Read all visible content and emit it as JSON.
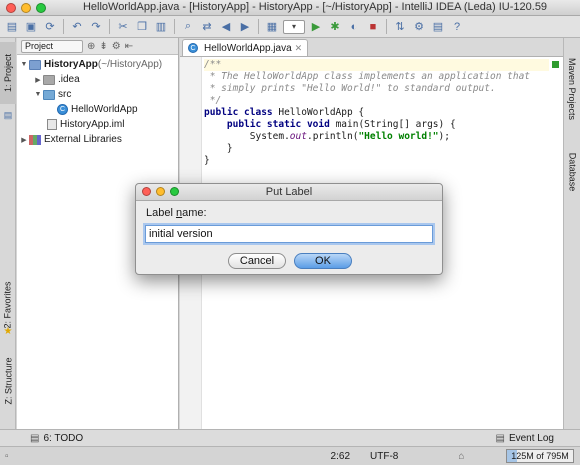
{
  "window": {
    "title": "HelloWorldApp.java - [HistoryApp] - HistoryApp - [~/HistoryApp] - IntelliJ IDEA (Leda) IU-120.59"
  },
  "toolbar": {
    "icons": [
      "open-icon",
      "save-icon",
      "sync-icon",
      "undo-icon",
      "redo-icon",
      "cut-icon",
      "copy-icon",
      "paste-icon",
      "find-icon",
      "replace-icon",
      "back-icon",
      "forward-icon",
      "make-icon",
      "run-config-combo",
      "run-icon",
      "debug-icon",
      "coverage-icon",
      "stop-icon",
      "vcs-icon",
      "settings-icon",
      "structure-icon",
      "help-icon"
    ]
  },
  "left_strip": {
    "project_tab": "1: Project",
    "favorites_tab": "2: Favorites",
    "structure_tab": "Z: Structure"
  },
  "right_strip": {
    "maven_tab": "Maven Projects",
    "database_tab": "Database"
  },
  "project_panel": {
    "view_selector": "Project",
    "tree": [
      {
        "label": "HistoryApp",
        "suffix": " (~/HistoryApp)",
        "level": 0,
        "expanded": true,
        "icon": "folder"
      },
      {
        "label": ".idea",
        "suffix": "",
        "level": 1,
        "expanded": false,
        "icon": "folder-plain"
      },
      {
        "label": "src",
        "suffix": "",
        "level": 1,
        "expanded": true,
        "icon": "folder-src"
      },
      {
        "label": "HelloWorldApp",
        "suffix": "",
        "level": 2,
        "expanded": null,
        "icon": "class"
      },
      {
        "label": "HistoryApp.iml",
        "suffix": "",
        "level": 1,
        "expanded": null,
        "icon": "iml"
      },
      {
        "label": "External Libraries",
        "suffix": "",
        "level": 0,
        "expanded": false,
        "icon": "library"
      }
    ]
  },
  "editor": {
    "tab_label": "HelloWorldApp.java",
    "code": {
      "l1": "/**",
      "l2": " * The HelloWorldApp class implements an application that",
      "l3": " * simply prints \"Hello World!\" to standard output.",
      "l4": " */",
      "l5a": "public class",
      "l5b": " HelloWorldApp {",
      "l6a": "    public static void",
      "l6b": " main(String[] args) {",
      "l7a": "        System.",
      "l7b": "out",
      "l7c": ".println(",
      "l7d": "\"Hello world!\"",
      "l7e": ");",
      "l8": "    }",
      "l9": "}"
    }
  },
  "dialog": {
    "title": "Put Label",
    "label_prefix": "Label ",
    "label_underlined": "n",
    "label_suffix": "ame:",
    "input_value": "initial version",
    "cancel": "Cancel",
    "ok": "OK"
  },
  "bottom": {
    "todo_tab": "6: TODO",
    "event_log": "Event Log",
    "position": "2:62",
    "encoding": "UTF-8",
    "memory": "125M of 795M",
    "memory_fraction": 0.157
  },
  "colors": {
    "keyword": "#000080",
    "string": "#008000",
    "comment": "#8a8a8a",
    "accent": "#5b9de6"
  }
}
